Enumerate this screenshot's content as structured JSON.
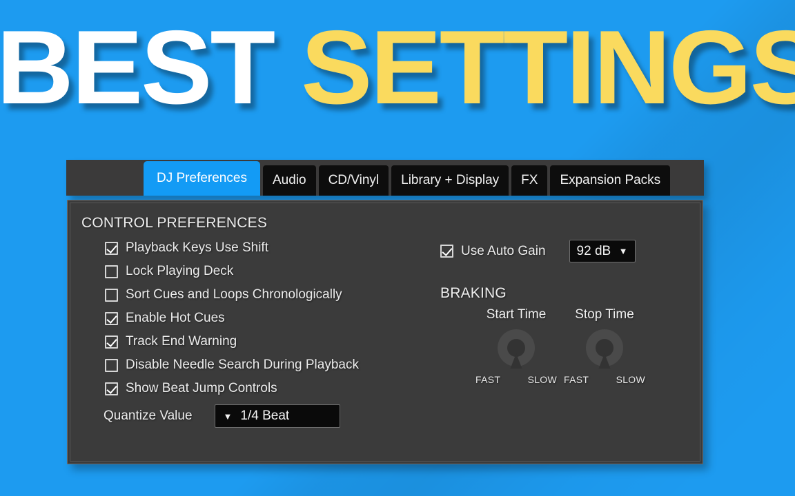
{
  "headline": {
    "word1": "BEST",
    "word2": "SETTINGS",
    "color_white": "#ffffff",
    "color_yellow": "#fada5e",
    "background_color": "#1d9bf0"
  },
  "tabs": [
    {
      "label": "DJ Preferences",
      "active": true
    },
    {
      "label": "Audio",
      "active": false
    },
    {
      "label": "CD/Vinyl",
      "active": false
    },
    {
      "label": "Library + Display",
      "active": false
    },
    {
      "label": "FX",
      "active": false
    },
    {
      "label": "Expansion Packs",
      "active": false
    }
  ],
  "tab_accent_color": "#139bf5",
  "panel": {
    "section_title": "CONTROL PREFERENCES",
    "checkboxes": [
      {
        "label": "Playback Keys Use Shift",
        "checked": true
      },
      {
        "label": "Lock Playing Deck",
        "checked": false
      },
      {
        "label": "Sort Cues and Loops Chronologically",
        "checked": false
      },
      {
        "label": "Enable Hot Cues",
        "checked": true
      },
      {
        "label": "Track End Warning",
        "checked": true
      },
      {
        "label": "Disable Needle Search During Playback",
        "checked": false
      },
      {
        "label": "Show Beat Jump Controls",
        "checked": true
      }
    ],
    "quantize": {
      "label": "Quantize Value",
      "value": "1/4 Beat",
      "caret": "▼"
    },
    "auto_gain": {
      "label": "Use Auto Gain",
      "checked": true,
      "value": "92 dB",
      "caret": "▼"
    },
    "braking": {
      "title": "BRAKING",
      "knobs": [
        {
          "label": "Start Time",
          "min_label": "FAST",
          "max_label": "SLOW"
        },
        {
          "label": "Stop Time",
          "min_label": "FAST",
          "max_label": "SLOW"
        }
      ]
    }
  }
}
